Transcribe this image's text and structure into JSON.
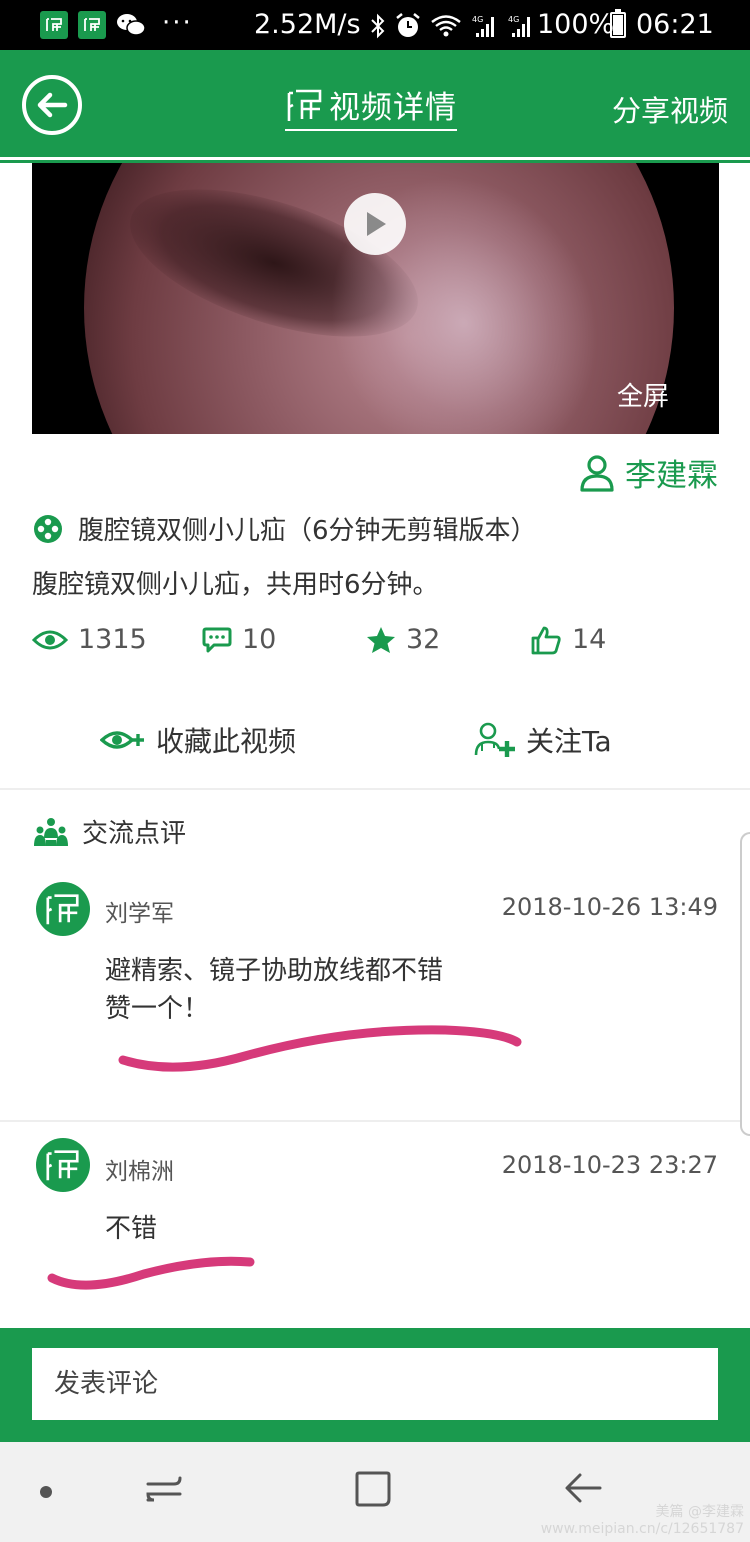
{
  "status_bar": {
    "speed": "2.52M/s",
    "battery": "100%",
    "time": "06:21",
    "dots": "···"
  },
  "header": {
    "title": "视频详情",
    "share_label": "分享视频"
  },
  "video": {
    "fullscreen_label": "全屏"
  },
  "author": {
    "name": "李建霖"
  },
  "info": {
    "title": "腹腔镜双侧小儿疝（6分钟无剪辑版本）",
    "description": "腹腔镜双侧小儿疝，共用时6分钟。"
  },
  "stats": {
    "views": "1315",
    "comments": "10",
    "stars": "32",
    "likes": "14"
  },
  "actions": {
    "favorite_label": "收藏此视频",
    "follow_label": "关注Ta"
  },
  "comments_section": {
    "heading": "交流点评",
    "items": [
      {
        "name": "刘学军",
        "time": "2018-10-26 13:49",
        "text": "避精索、镜子协助放线都不错\n赞一个！"
      },
      {
        "name": "刘棉洲",
        "time": "2018-10-23 23:27",
        "text": "不错"
      }
    ]
  },
  "comment_bar": {
    "placeholder": "发表评论"
  },
  "watermark": {
    "line1": "美篇 @李建霖",
    "line2": "www.meipian.cn/c/12651787"
  },
  "colors": {
    "brand_green": "#1a9a4e",
    "annotation_pink": "#d63a7a"
  }
}
